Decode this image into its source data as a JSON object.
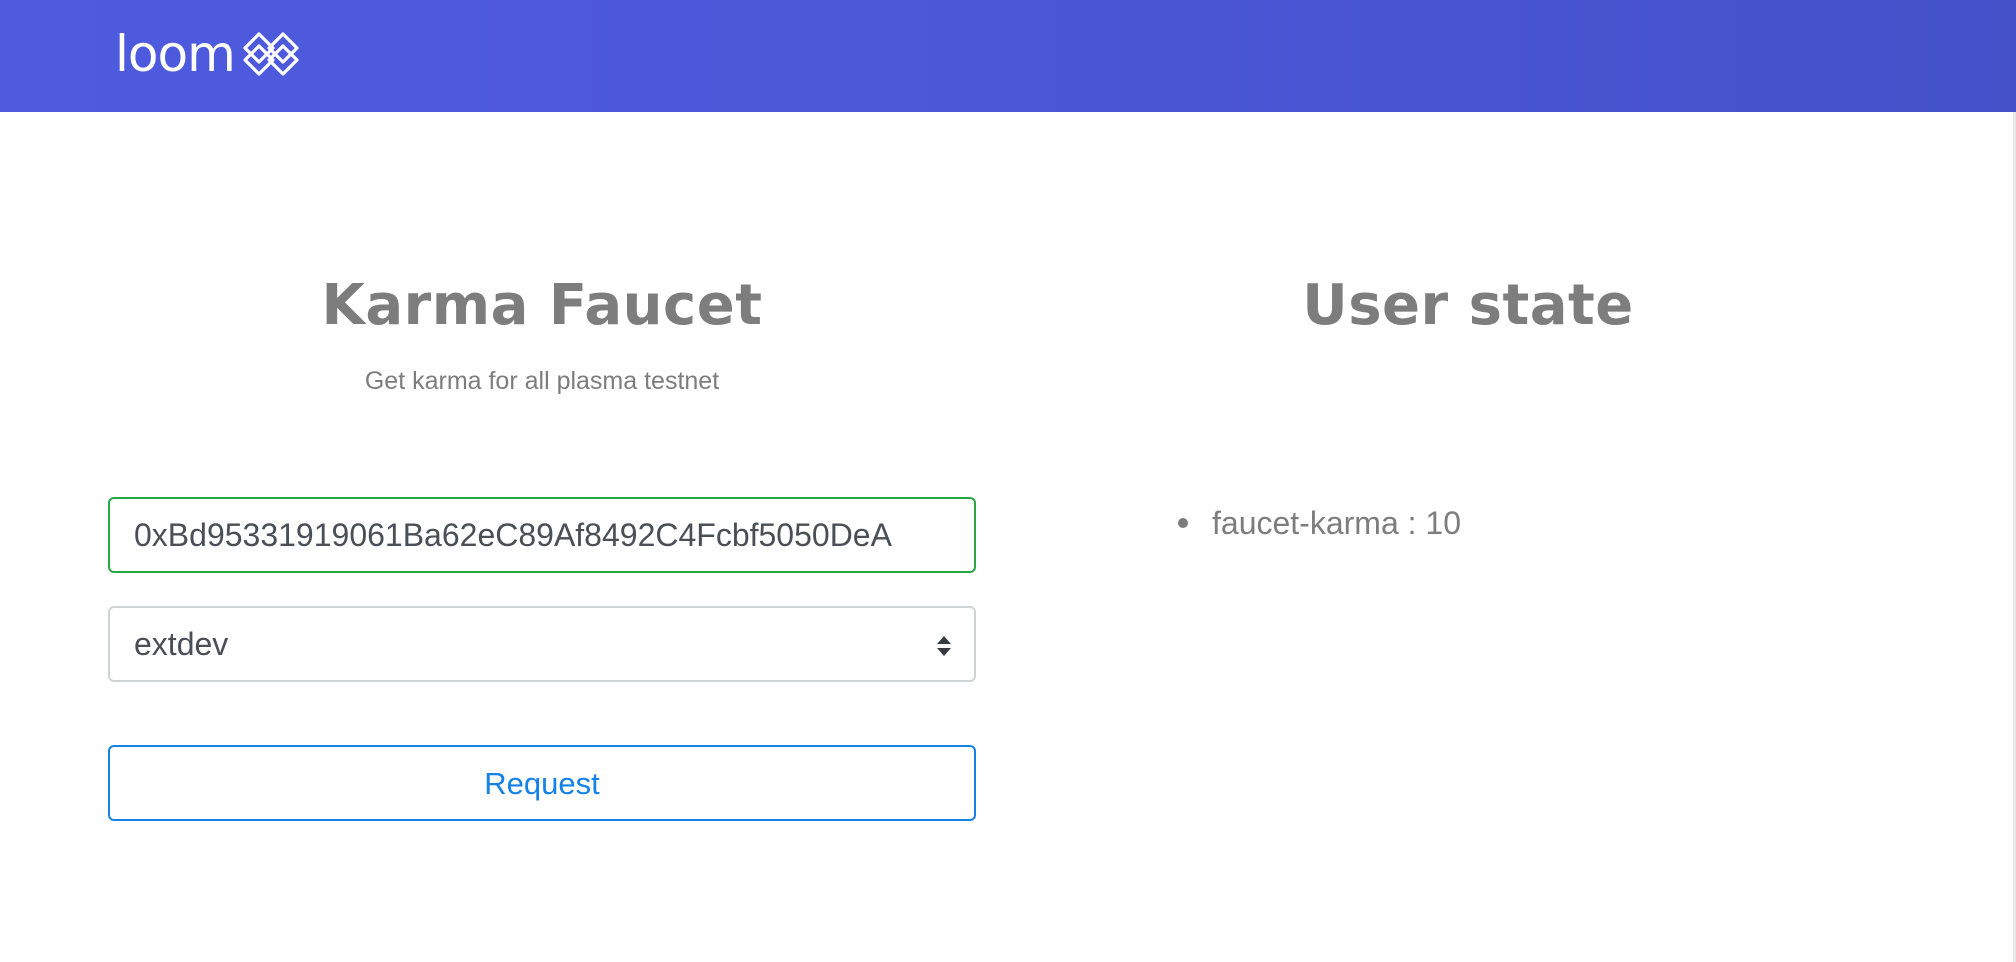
{
  "header": {
    "logo_text": "loom",
    "logo_icon": "loom-knot-icon",
    "background_colors": [
      "#4f5bdf",
      "#4451c9"
    ]
  },
  "faucet": {
    "title": "Karma Faucet",
    "subtitle": "Get karma for all plasma testnet",
    "address_value": "0xBd95331919061Ba62eC89Af8492C4Fcbf5050DeA",
    "network_selected": "extdev",
    "request_label": "Request",
    "accent_color": "#1482e6",
    "valid_color": "#28a745"
  },
  "user_state": {
    "title": "User state",
    "items": [
      {
        "text": "faucet-karma : 10"
      }
    ]
  }
}
